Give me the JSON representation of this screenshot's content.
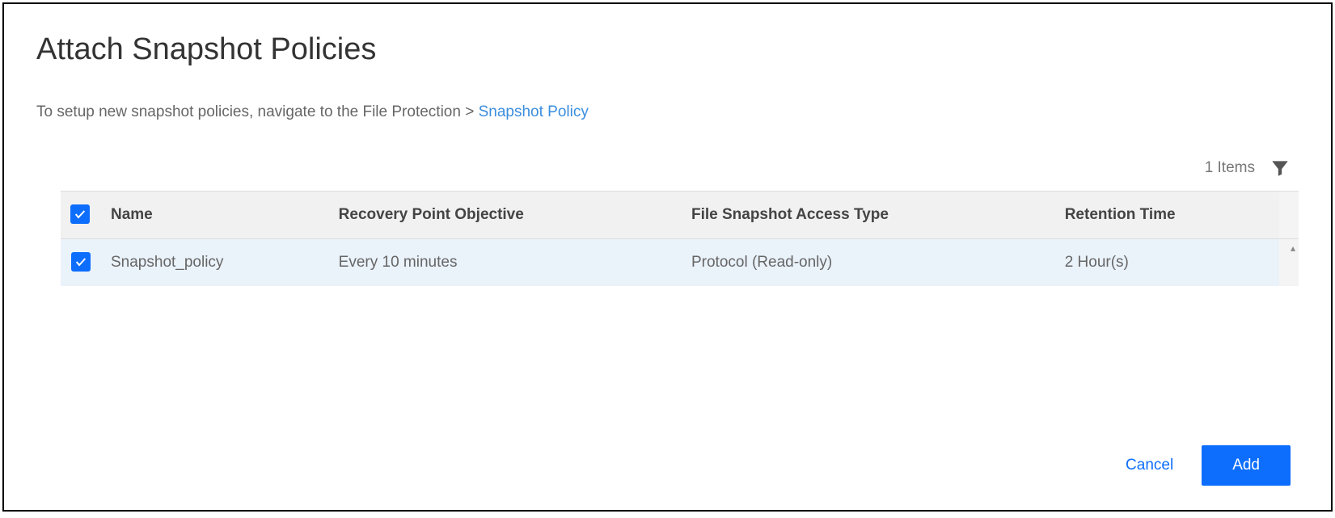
{
  "title": "Attach Snapshot Policies",
  "instruction": {
    "prefix": "To setup new snapshot policies, navigate to the File Protection > ",
    "link": "Snapshot Policy"
  },
  "toolbar": {
    "items_count": "1 Items"
  },
  "table": {
    "headers": {
      "name": "Name",
      "rpo": "Recovery Point Objective",
      "access_type": "File Snapshot Access Type",
      "retention": "Retention Time"
    },
    "rows": [
      {
        "checked": true,
        "name": "Snapshot_policy",
        "rpo": "Every 10 minutes",
        "access_type": "Protocol (Read-only)",
        "retention": "2 Hour(s)"
      }
    ]
  },
  "footer": {
    "cancel": "Cancel",
    "add": "Add"
  }
}
